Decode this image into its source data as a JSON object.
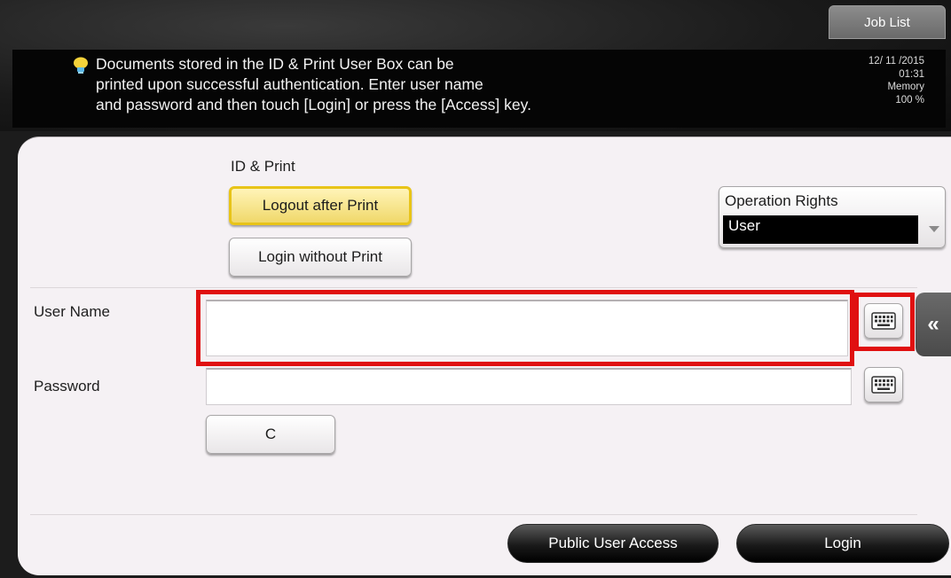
{
  "header": {
    "job_list_label": "Job List",
    "message_line1": "Documents stored in the ID & Print User Box can be",
    "message_line2": "printed upon successful authentication. Enter user name",
    "message_line3": "and password and then touch [Login] or press the [Access] key.",
    "date": "12/ 11 /2015",
    "time": "01:31",
    "memory_label": "Memory",
    "memory_value": "100 %"
  },
  "id_print": {
    "section_label": "ID & Print",
    "logout_after_print": "Logout after Print",
    "login_without_print": "Login without Print"
  },
  "operation_rights": {
    "label": "Operation Rights",
    "selected": "User"
  },
  "form": {
    "user_name_label": "User Name",
    "user_name_value": "",
    "password_label": "Password",
    "password_value": "",
    "clear_label": "C"
  },
  "footer": {
    "public_user_access": "Public User Access",
    "login": "Login"
  },
  "icons": {
    "message": "lightbulb-icon",
    "keyboard": "keyboard-icon",
    "side_tab": "double-chevron-left-icon"
  },
  "colors": {
    "highlight": "#e01010",
    "selected_button": "#f0d86a"
  }
}
